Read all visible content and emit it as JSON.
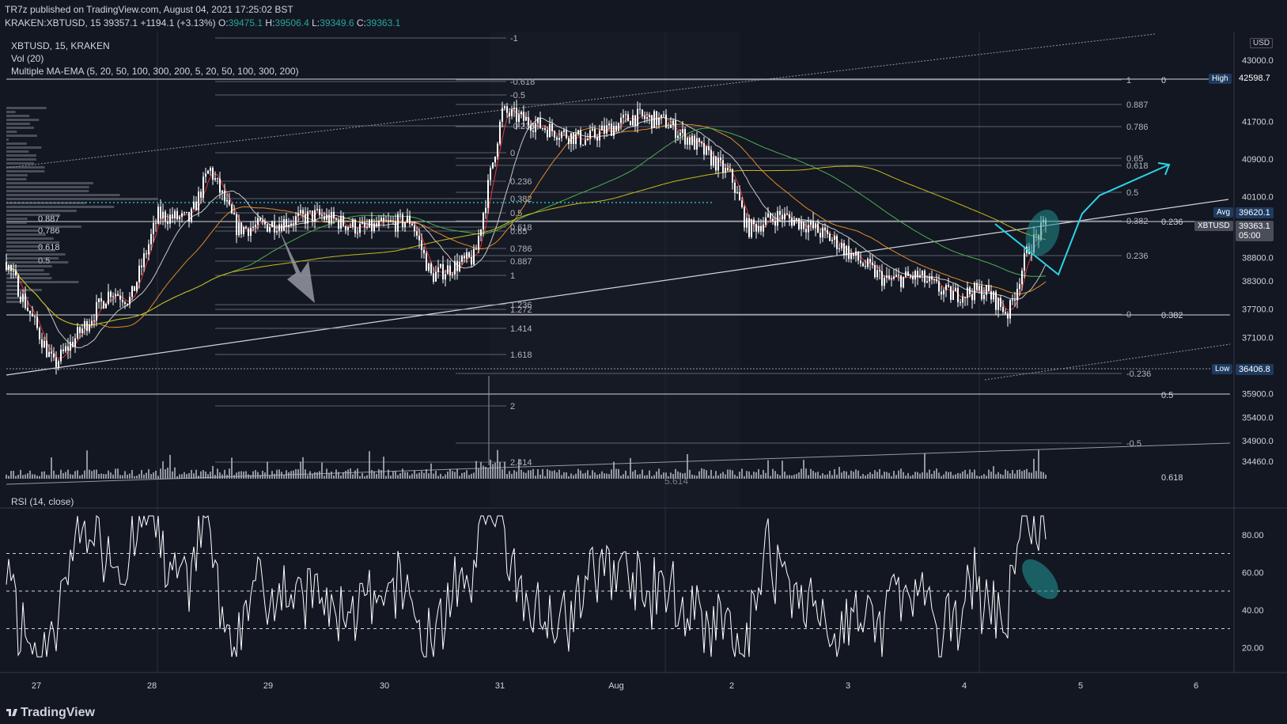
{
  "header": {
    "published": "TR7z published on TradingView.com, August 04, 2021 17:25:02 BST",
    "symbol": "KRAKEN:XBTUSD, 15",
    "last": "39357.1",
    "change": "+1194.1 (+3.13%)",
    "o_label": "O:",
    "o": "39475.1",
    "h_label": "H:",
    "h": "39506.4",
    "l_label": "L:",
    "l": "39349.6",
    "c_label": "C:",
    "c": "39363.1"
  },
  "legend": {
    "title": "XBTUSD, 15, KRAKEN",
    "vol": "Vol (20)",
    "ma": "Multiple MA-EMA (5, 20, 50, 100, 300, 200, 5, 20, 50, 100, 300, 200)",
    "rsi": "RSI (14, close)"
  },
  "colors": {
    "background": "#131722",
    "candle": "#ffffff",
    "accent_cyan": "#2ad4e6",
    "ellipse": "#1f8f8f",
    "ma_red": "#e53935",
    "ma_orange": "#e08a2a",
    "ma_green": "#4caf50",
    "ma_yellow": "#c9b81b",
    "ma_white": "#c8c8c8"
  },
  "price_axis": {
    "currency": "USD",
    "ticks": [
      "43000.0",
      "41700.0",
      "40900.0",
      "40100.0",
      "38800.0",
      "38300.0",
      "37700.0",
      "37100.0",
      "35900.0",
      "35400.0",
      "34900.0",
      "34460.0"
    ],
    "high_label": "High",
    "high_value": "42598.7",
    "avg_label": "Avg",
    "avg_value": "39620.1",
    "low_label": "Low",
    "low_value": "36406.8",
    "last_symbol": "XBTUSD",
    "last_value": "39363.1",
    "countdown": "05:00"
  },
  "rsi_axis": {
    "ticks": [
      "80.00",
      "60.00",
      "40.00",
      "20.00"
    ]
  },
  "time_axis": {
    "labels": [
      "27",
      "28",
      "29",
      "30",
      "31",
      "Aug",
      "2",
      "3",
      "4",
      "5",
      "6"
    ]
  },
  "fib_left": [
    "0.887",
    "0.786",
    "0.618",
    "0.5"
  ],
  "fib_mid": [
    "-1",
    "-0.618",
    "-0.5",
    "-0.236",
    "0",
    "0.236",
    "0.382",
    "0.5",
    "0.618",
    "0.65",
    "0.786",
    "0.887",
    "1",
    "1.236",
    "1.272",
    "1.414",
    "1.618",
    "2",
    "2.414"
  ],
  "fib_right": [
    "1",
    "0.887",
    "0.786",
    "0.65",
    "0.618",
    "0.5",
    "0.382",
    "0.236",
    "0",
    "-0.236",
    "-0.5"
  ],
  "fib_far": [
    "0",
    "0.236",
    "0.382",
    "0.5",
    "0.618"
  ],
  "volume_label": "5.614",
  "footer": {
    "brand": "TradingView"
  },
  "chart_data": {
    "type": "line",
    "title": "XBTUSD, 15, KRAKEN",
    "xlabel": "",
    "ylabel": "",
    "x": [
      "27",
      "28",
      "29",
      "30",
      "31",
      "Aug",
      "2",
      "3",
      "4",
      "5",
      "6"
    ],
    "ylim": [
      34000,
      43300
    ],
    "series": [
      {
        "name": "XBTUSD",
        "values": [
          37300,
          39700,
          39500,
          38900,
          41800,
          42000,
          39400,
          38500,
          37800,
          39363.1
        ]
      }
    ],
    "rsi_levels": [
      70,
      50,
      30
    ]
  }
}
